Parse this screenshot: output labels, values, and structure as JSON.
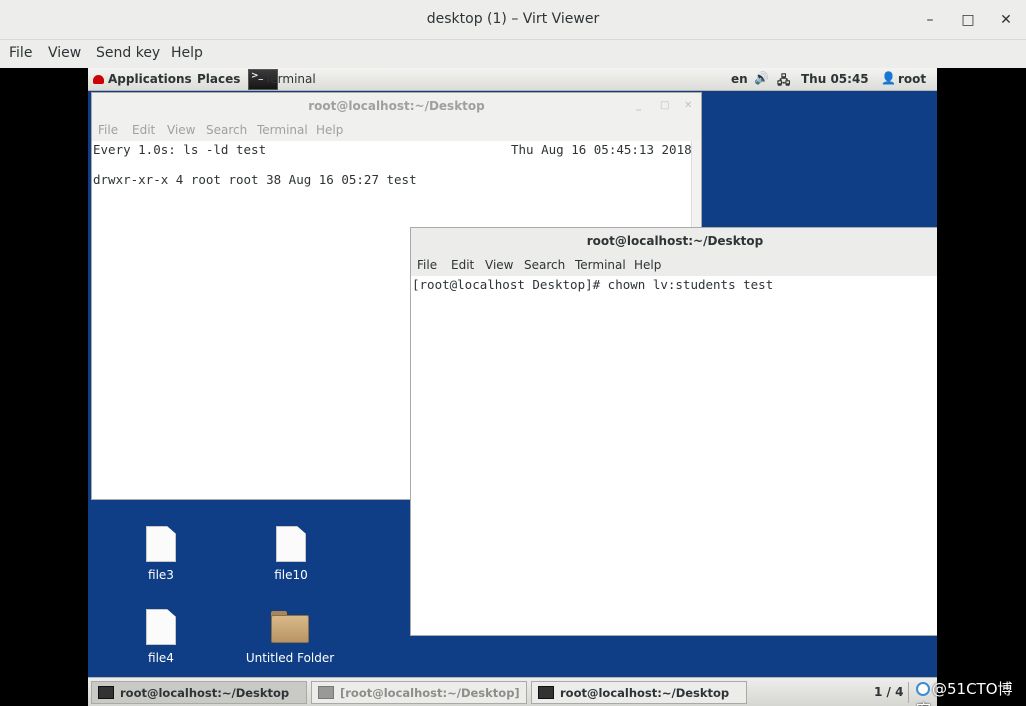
{
  "window": {
    "title": "desktop (1) – Virt Viewer",
    "minimize": "–",
    "maximize": "□",
    "close": "✕"
  },
  "menubar": [
    "File",
    "View",
    "Send key",
    "Help"
  ],
  "topbar": {
    "applications": "Applications",
    "places": "Places",
    "taskbar_app": "Terminal",
    "thumb_glyph": ">_",
    "lang": "en",
    "volume_icon": "🔊",
    "network_icon": "🖧",
    "clock": "Thu 05:45",
    "user_icon": "👤",
    "user": "root"
  },
  "term1": {
    "title": "root@localhost:~/Desktop",
    "menu": [
      "File",
      "Edit",
      "View",
      "Search",
      "Terminal",
      "Help"
    ],
    "lines": [
      "Every 1.0s: ls -ld test",
      "",
      "drwxr-xr-x 4 root root 38 Aug 16 05:27 test"
    ],
    "timestamp": "Thu Aug 16 05:45:13 2018"
  },
  "term2": {
    "title": "root@localhost:~/Desktop",
    "menu": [
      "File",
      "Edit",
      "View",
      "Search",
      "Terminal",
      "Help"
    ],
    "lines": [
      "[root@localhost Desktop]# chown lv:students test"
    ]
  },
  "desktop_icons": [
    {
      "label": "file3",
      "kind": "document"
    },
    {
      "label": "file10",
      "kind": "document"
    },
    {
      "label": "file4",
      "kind": "document"
    },
    {
      "label": "Untitled Folder",
      "kind": "folder"
    }
  ],
  "taskbar": {
    "items": [
      "root@localhost:~/Desktop",
      "[root@localhost:~/Desktop]",
      "root@localhost:~/Desktop"
    ],
    "pager": "1 / 4"
  },
  "watermark": "@51CTO博客",
  "colors": {
    "desktop_bg": "#0f3d86",
    "redhat_red": "#cc0000"
  }
}
